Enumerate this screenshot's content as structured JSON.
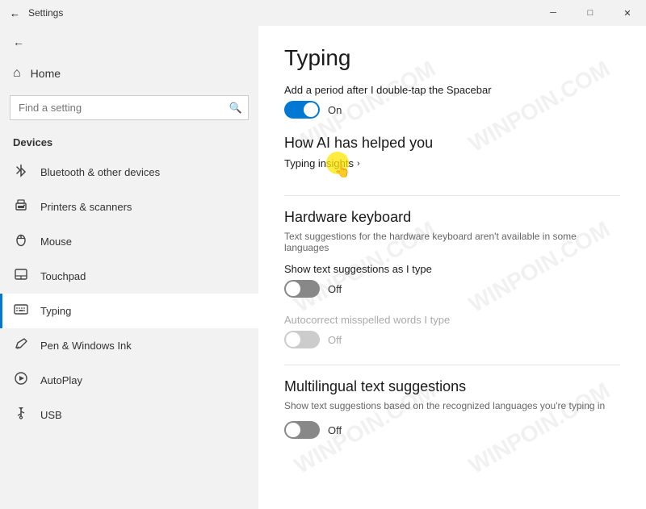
{
  "titlebar": {
    "title": "Settings",
    "btn_minimize": "─",
    "btn_maximize": "□",
    "btn_close": "✕"
  },
  "sidebar": {
    "search_placeholder": "Find a setting",
    "section_title": "Devices",
    "items": [
      {
        "id": "bluetooth",
        "label": "Bluetooth & other devices",
        "icon": "🔵"
      },
      {
        "id": "printers",
        "label": "Printers & scanners",
        "icon": "🖨"
      },
      {
        "id": "mouse",
        "label": "Mouse",
        "icon": "🖱"
      },
      {
        "id": "touchpad",
        "label": "Touchpad",
        "icon": "⬜"
      },
      {
        "id": "typing",
        "label": "Typing",
        "icon": "⌨"
      },
      {
        "id": "pen",
        "label": "Pen & Windows Ink",
        "icon": "✏"
      },
      {
        "id": "autoplay",
        "label": "AutoPlay",
        "icon": "▶"
      },
      {
        "id": "usb",
        "label": "USB",
        "icon": "⚡"
      }
    ]
  },
  "content": {
    "page_title": "Typing",
    "spacebar_label": "Add a period after I double-tap the Spacebar",
    "spacebar_on": true,
    "spacebar_status": "On",
    "ai_section_title": "How AI has helped you",
    "typing_insights_link": "Typing insights",
    "hardware_section_title": "Hardware keyboard",
    "hardware_desc": "Text suggestions for the hardware keyboard aren't available in some languages",
    "text_suggest_label": "Show text suggestions as I type",
    "text_suggest_on": false,
    "text_suggest_status": "Off",
    "autocorrect_label": "Autocorrect misspelled words I type",
    "autocorrect_on": false,
    "autocorrect_status": "Off",
    "autocorrect_disabled": true,
    "multilingual_title": "Multilingual text suggestions",
    "multilingual_desc": "Show text suggestions based on the recognized languages you're typing in",
    "multilingual_on": false,
    "multilingual_status": "Off"
  },
  "watermark_text": "WINPOIN.COM"
}
